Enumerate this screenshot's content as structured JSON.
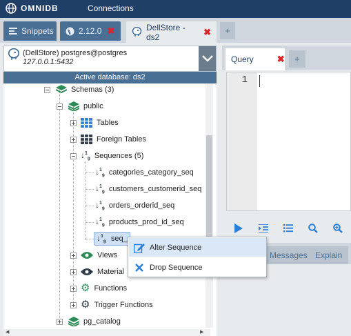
{
  "header": {
    "logo_text": "OMNIDB",
    "connections_label": "Connections"
  },
  "tabs": [
    {
      "label": "Snippets",
      "icon": "list-icon",
      "closable": false,
      "active": false
    },
    {
      "label": "2.12.0",
      "icon": "globe-icon",
      "closable": true,
      "active": false
    },
    {
      "label": "DellStore - ds2",
      "icon": "postgres-icon",
      "closable": true,
      "active": true
    }
  ],
  "tab_add_label": "+",
  "connection": {
    "title": "(DellStore) postgres@postgres",
    "host": "127.0.0.1:5432"
  },
  "active_database": "Active database: ds2",
  "tree": {
    "schemas": "Schemas (3)",
    "public": "public",
    "tables": "Tables",
    "foreign_tables": "Foreign Tables",
    "sequences": "Sequences (5)",
    "sequence_items": [
      "categories_category_seq",
      "customers_customerid_seq",
      "orders_orderid_seq",
      "products_prod_id_seq",
      "seq_"
    ],
    "views": "Views",
    "materialized_views": "Material",
    "functions": "Functions",
    "trigger_functions": "Trigger Functions",
    "pg_catalog": "pg_catalog"
  },
  "context_menu": {
    "alter": "Alter Sequence",
    "drop": "Drop Sequence"
  },
  "query_tab": {
    "label": "Query",
    "add_label": "+"
  },
  "editor": {
    "line_number": "1"
  },
  "result_tabs": {
    "messages": "Messages",
    "explain": "Explain"
  },
  "colors": {
    "header": "#1f3f66",
    "accent": "#4a6f95",
    "close": "#d9262a"
  }
}
